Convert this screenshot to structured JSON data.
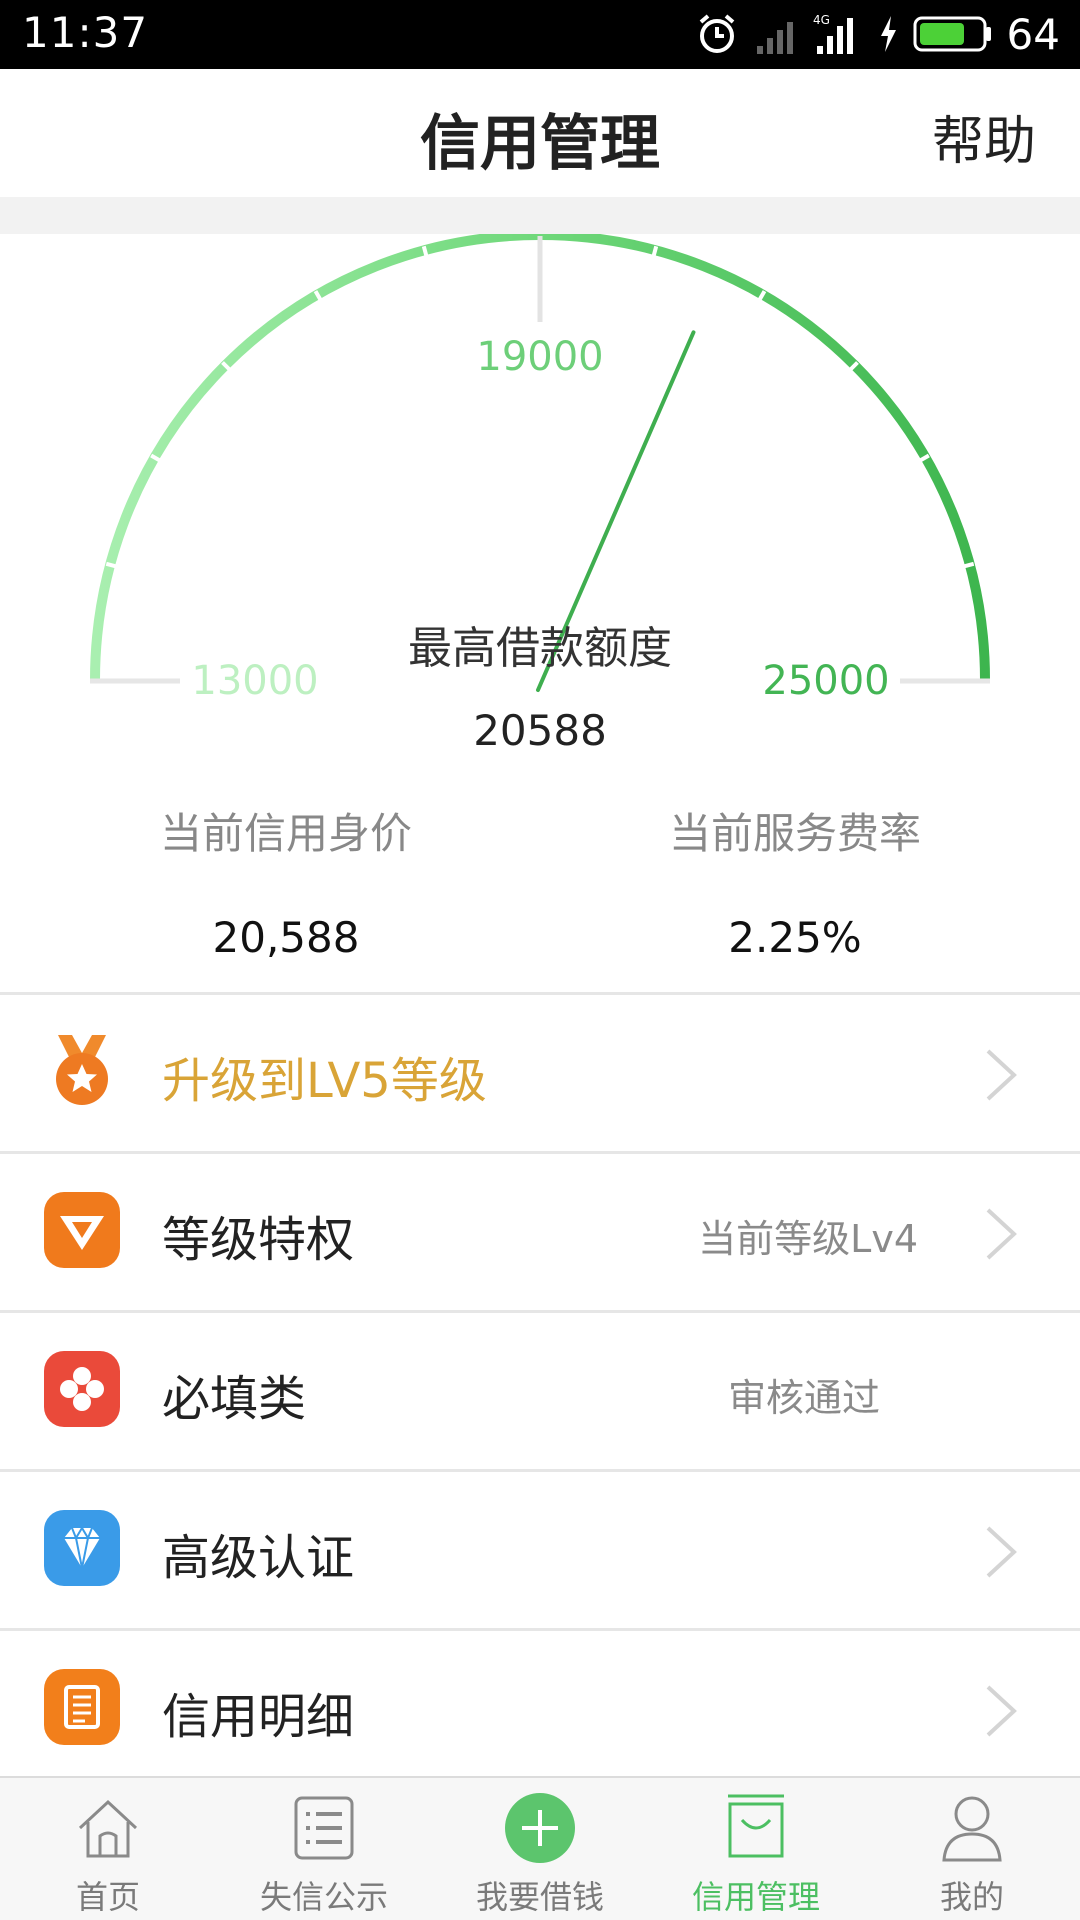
{
  "status_bar": {
    "time": "11:37",
    "battery": "64",
    "network": "4G"
  },
  "header": {
    "title": "信用管理",
    "help": "帮助"
  },
  "gauge": {
    "min_label": "13000",
    "mid_label": "19000",
    "max_label": "25000",
    "caption": "最高借款额度",
    "value_text": "20588",
    "min": 13000,
    "max": 25000,
    "value": 20588
  },
  "stats": {
    "credit_label": "当前信用身价",
    "credit_value": "20,588",
    "rate_label": "当前服务费率",
    "rate_value": "2.25%"
  },
  "menu": [
    {
      "label": "升级到LV5等级",
      "right": "",
      "icon": "medal-icon",
      "color": "#ee7a22",
      "arrow": true
    },
    {
      "label": "等级特权",
      "right": "当前等级Lv4",
      "icon": "v-badge-icon",
      "color": "#f07a1c",
      "arrow": true
    },
    {
      "label": "必填类",
      "right": "审核通过",
      "icon": "clover-icon",
      "color": "#ea4a3a",
      "arrow": false
    },
    {
      "label": "高级认证",
      "right": "",
      "icon": "diamond-icon",
      "color": "#3a9be8",
      "arrow": true
    },
    {
      "label": "信用明细",
      "right": "",
      "icon": "document-icon",
      "color": "#f27f1b",
      "arrow": true
    }
  ],
  "tabs": [
    {
      "label": "首页",
      "icon": "home-icon",
      "active": false
    },
    {
      "label": "失信公示",
      "icon": "list-icon",
      "active": false
    },
    {
      "label": "我要借钱",
      "icon": "plus-circle-icon",
      "active": false
    },
    {
      "label": "信用管理",
      "icon": "bag-icon",
      "active": true
    },
    {
      "label": "我的",
      "icon": "person-icon",
      "active": false
    }
  ],
  "colors": {
    "accent": "#4cbf62",
    "gold": "#d9a437"
  }
}
